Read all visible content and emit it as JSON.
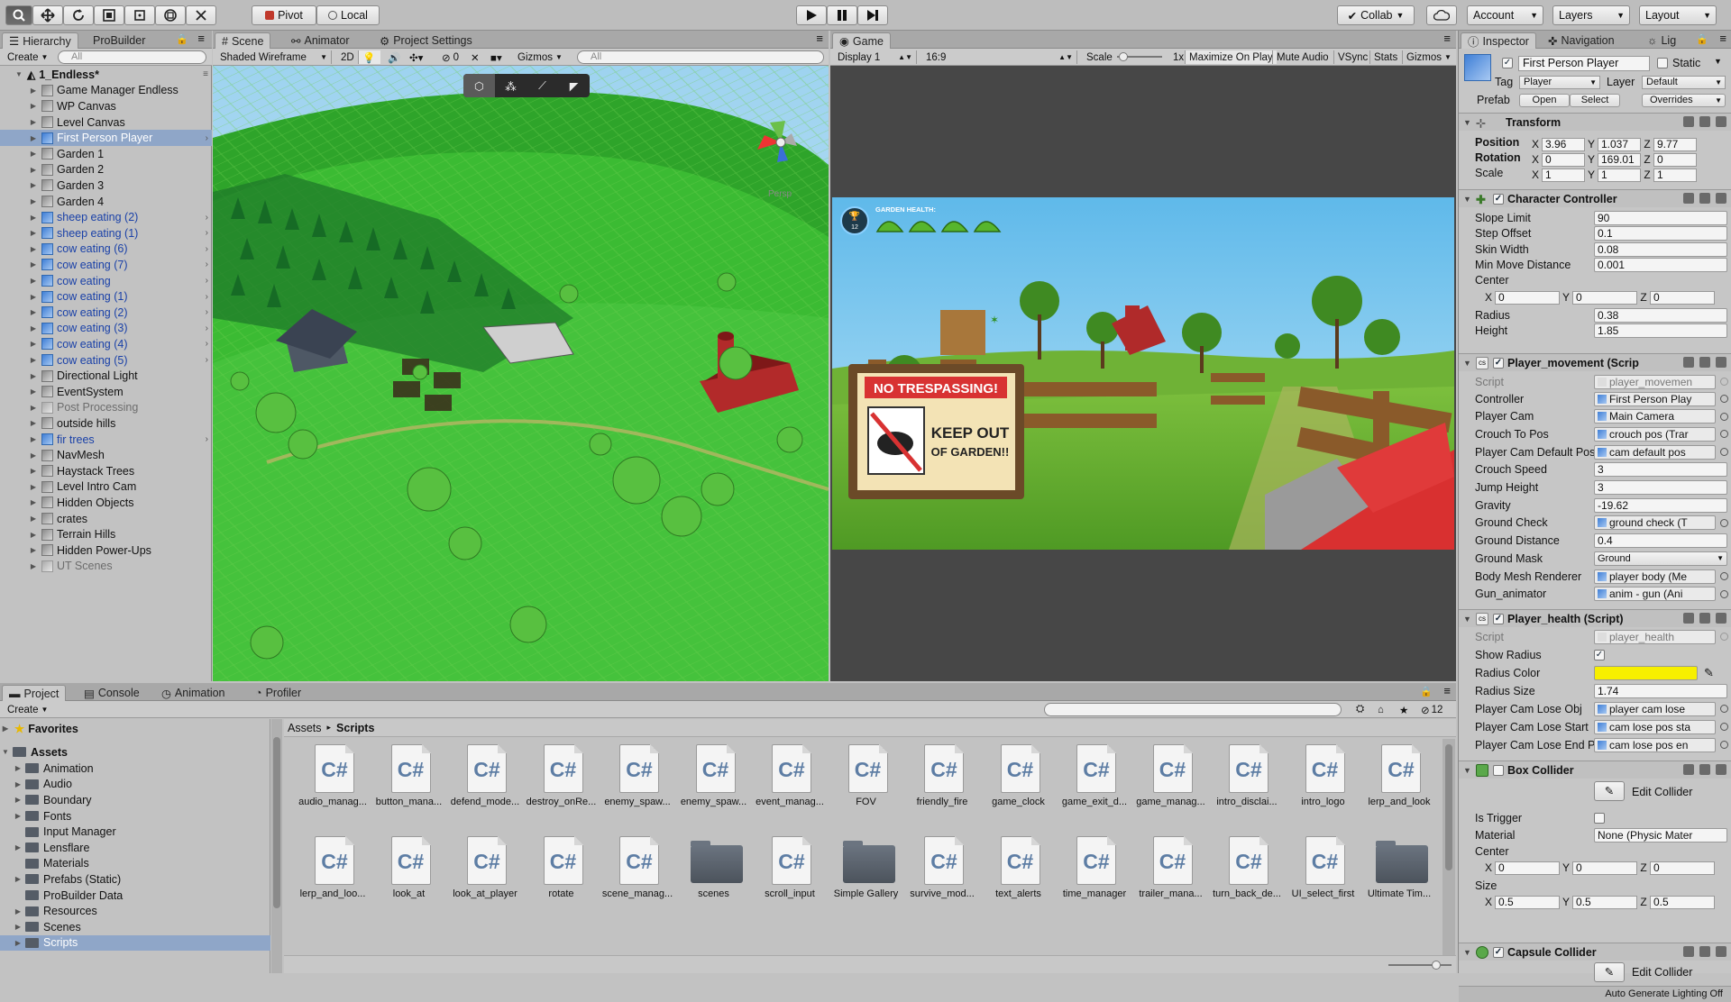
{
  "toolbar": {
    "pivot": "Pivot",
    "local": "Local",
    "collab": "Collab",
    "account": "Account",
    "layers": "Layers",
    "layout": "Layout"
  },
  "hierarchy": {
    "tab": "Hierarchy",
    "tab2": "ProBuilder",
    "create": "Create",
    "search": "All",
    "scene": "1_Endless*",
    "items": [
      {
        "label": "Game Manager Endless",
        "type": "plain"
      },
      {
        "label": "WP Canvas",
        "type": "plain"
      },
      {
        "label": "Level Canvas",
        "type": "plain"
      },
      {
        "label": "First Person Player",
        "type": "sel"
      },
      {
        "label": "Garden 1",
        "type": "plain"
      },
      {
        "label": "Garden 2",
        "type": "plain"
      },
      {
        "label": "Garden 3",
        "type": "plain"
      },
      {
        "label": "Garden 4",
        "type": "plain"
      },
      {
        "label": "sheep eating (2)",
        "type": "pref"
      },
      {
        "label": "sheep eating (1)",
        "type": "pref"
      },
      {
        "label": "cow eating (6)",
        "type": "pref"
      },
      {
        "label": "cow eating (7)",
        "type": "pref"
      },
      {
        "label": "cow eating",
        "type": "pref"
      },
      {
        "label": "cow eating (1)",
        "type": "pref"
      },
      {
        "label": "cow eating (2)",
        "type": "pref"
      },
      {
        "label": "cow eating (3)",
        "type": "pref"
      },
      {
        "label": "cow eating (4)",
        "type": "pref"
      },
      {
        "label": "cow eating (5)",
        "type": "pref"
      },
      {
        "label": "Directional Light",
        "type": "plain"
      },
      {
        "label": "EventSystem",
        "type": "plain"
      },
      {
        "label": "Post Processing",
        "type": "dis"
      },
      {
        "label": "outside hills",
        "type": "plain"
      },
      {
        "label": "fir trees",
        "type": "pref"
      },
      {
        "label": "NavMesh",
        "type": "plain"
      },
      {
        "label": "Haystack Trees",
        "type": "plain"
      },
      {
        "label": "Level Intro Cam",
        "type": "plain"
      },
      {
        "label": "Hidden Objects",
        "type": "plain"
      },
      {
        "label": "crates",
        "type": "plain"
      },
      {
        "label": "Terrain Hills",
        "type": "plain"
      },
      {
        "label": "Hidden Power-Ups",
        "type": "plain"
      },
      {
        "label": "UT Scenes",
        "type": "dis"
      }
    ]
  },
  "scene": {
    "tab1": "Scene",
    "tab2": "Animator",
    "tab3": "Project Settings",
    "shading": "Shaded Wireframe",
    "mode2d": "2D",
    "hidden": "0",
    "gizmos": "Gizmos",
    "search": "All",
    "persp": "Persp"
  },
  "game": {
    "tab": "Game",
    "display": "Display 1",
    "aspect": "16:9",
    "scale_label": "Scale",
    "scale_value": "1x",
    "maximize": "Maximize On Play",
    "mute": "Mute Audio",
    "vsync": "VSync",
    "stats": "Stats",
    "gizmos": "Gizmos",
    "health_label": "GARDEN HEALTH:",
    "trophy": "12",
    "sign_top": "NO TRESPASSING!",
    "sign_line1": "KEEP OUT",
    "sign_line2": "OF GARDEN!!"
  },
  "inspector": {
    "tab1": "Inspector",
    "tab2": "Navigation",
    "tab3": "Lig",
    "name": "First Person Player",
    "static": "Static",
    "tag_label": "Tag",
    "tag": "Player",
    "layer_label": "Layer",
    "layer": "Default",
    "prefab_label": "Prefab",
    "open": "Open",
    "select": "Select",
    "overrides": "Overrides",
    "transform": {
      "title": "Transform",
      "pos_label": "Position",
      "rot_label": "Rotation",
      "scale_label": "Scale",
      "pos": [
        "3.96",
        "1.037",
        "9.77"
      ],
      "rot": [
        "0",
        "169.01",
        "0"
      ],
      "scale": [
        "1",
        "1",
        "1"
      ]
    },
    "cc": {
      "title": "Character Controller",
      "rows": [
        [
          "Slope Limit",
          "90"
        ],
        [
          "Step Offset",
          "0.1"
        ],
        [
          "Skin Width",
          "0.08"
        ],
        [
          "Min Move Distance",
          "0.001"
        ]
      ],
      "center_label": "Center",
      "center": [
        "0",
        "0",
        "0"
      ],
      "rows2": [
        [
          "Radius",
          "0.38"
        ],
        [
          "Height",
          "1.85"
        ]
      ]
    },
    "pm": {
      "title": "Player_movement (Scrip",
      "script_label": "Script",
      "script": "player_movemen",
      "rows": [
        [
          "Controller",
          "First Person Play",
          "obj"
        ],
        [
          "Player Cam",
          "Main Camera",
          "obj"
        ],
        [
          "Crouch To Pos",
          "crouch pos (Trar",
          "obj"
        ],
        [
          "Player Cam Default Pos",
          "cam default pos",
          "obj"
        ],
        [
          "Crouch Speed",
          "3",
          "v"
        ],
        [
          "Jump Height",
          "3",
          "v"
        ],
        [
          "Gravity",
          "-19.62",
          "v"
        ],
        [
          "Ground Check",
          "ground check (T",
          "obj"
        ],
        [
          "Ground Distance",
          "0.4",
          "v"
        ],
        [
          "Ground Mask",
          "Ground",
          "dd"
        ],
        [
          "Body Mesh Renderer",
          "player body (Me",
          "obj"
        ],
        [
          "Gun_animator",
          "anim - gun (Ani",
          "obj"
        ]
      ]
    },
    "ph": {
      "title": "Player_health (Script)",
      "script_label": "Script",
      "script": "player_health",
      "show_radius": "Show Radius",
      "radius_color_label": "Radius Color",
      "radius_color": "#f7ef00",
      "radius_size_label": "Radius Size",
      "radius_size": "1.74",
      "rows": [
        [
          "Player Cam Lose Obj",
          "player cam lose"
        ],
        [
          "Player Cam Lose Start",
          "cam lose pos sta"
        ],
        [
          "Player Cam Lose End P",
          "cam lose pos en"
        ]
      ]
    },
    "bc": {
      "title": "Box Collider",
      "edit": "Edit Collider",
      "trigger": "Is Trigger",
      "material_label": "Material",
      "material": "None (Physic Mater",
      "center_label": "Center",
      "center": [
        "0",
        "0",
        "0"
      ],
      "size_label": "Size",
      "size": [
        "0.5",
        "0.5",
        "0.5"
      ]
    },
    "cap": {
      "title": "Capsule Collider",
      "edit": "Edit Collider"
    },
    "status": "Auto Generate Lighting Off"
  },
  "project": {
    "tab1": "Project",
    "tab2": "Console",
    "tab3": "Animation",
    "tab4": "Profiler",
    "create": "Create",
    "badge": "12",
    "favorites": "Favorites",
    "assets": "Assets",
    "folders": [
      "Animation",
      "Audio",
      "Boundary",
      "Fonts",
      "Input Manager",
      "Lensflare",
      "Materials",
      "Prefabs (Static)",
      "ProBuilder Data",
      "Resources",
      "Scenes",
      "Scripts"
    ],
    "breadcrumb1": "Assets",
    "breadcrumb2": "Scripts",
    "files": [
      {
        "name": "audio_manag...",
        "kind": "cs"
      },
      {
        "name": "button_mana...",
        "kind": "cs"
      },
      {
        "name": "defend_mode...",
        "kind": "cs"
      },
      {
        "name": "destroy_onRe...",
        "kind": "cs"
      },
      {
        "name": "enemy_spaw...",
        "kind": "cs"
      },
      {
        "name": "enemy_spaw...",
        "kind": "cs"
      },
      {
        "name": "event_manag...",
        "kind": "cs"
      },
      {
        "name": "FOV",
        "kind": "cs"
      },
      {
        "name": "friendly_fire",
        "kind": "cs"
      },
      {
        "name": "game_clock",
        "kind": "cs"
      },
      {
        "name": "game_exit_d...",
        "kind": "cs"
      },
      {
        "name": "game_manag...",
        "kind": "cs"
      },
      {
        "name": "intro_disclai...",
        "kind": "cs"
      },
      {
        "name": "intro_logo",
        "kind": "cs"
      },
      {
        "name": "lerp_and_look",
        "kind": "cs"
      },
      {
        "name": "lerp_and_loo...",
        "kind": "cs"
      },
      {
        "name": "look_at",
        "kind": "cs"
      },
      {
        "name": "look_at_player",
        "kind": "cs"
      },
      {
        "name": "rotate",
        "kind": "cs"
      },
      {
        "name": "scene_manag...",
        "kind": "cs"
      },
      {
        "name": "scenes",
        "kind": "folder"
      },
      {
        "name": "scroll_input",
        "kind": "cs"
      },
      {
        "name": "Simple Gallery",
        "kind": "folder"
      },
      {
        "name": "survive_mod...",
        "kind": "cs"
      },
      {
        "name": "text_alerts",
        "kind": "cs"
      },
      {
        "name": "time_manager",
        "kind": "cs"
      },
      {
        "name": "trailer_mana...",
        "kind": "cs"
      },
      {
        "name": "turn_back_de...",
        "kind": "cs"
      },
      {
        "name": "UI_select_first",
        "kind": "cs"
      },
      {
        "name": "Ultimate Tim...",
        "kind": "folder"
      }
    ]
  }
}
